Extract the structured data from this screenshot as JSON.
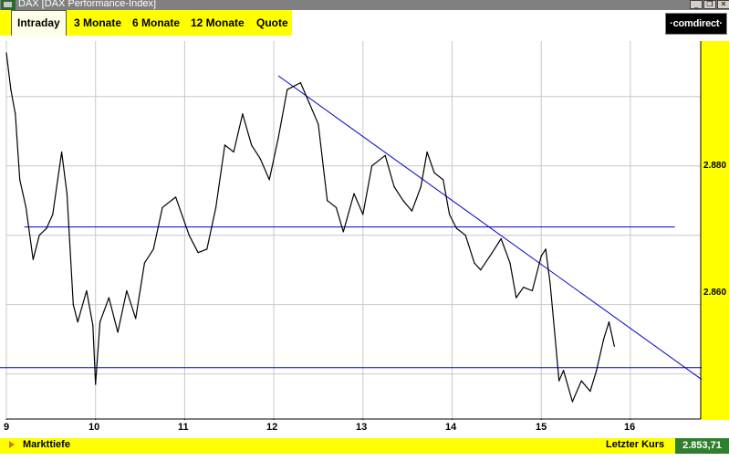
{
  "window": {
    "title": "DAX [DAX Performance-Index]",
    "buttons": [
      {
        "name": "minimize",
        "glyph": "_"
      },
      {
        "name": "maximize",
        "glyph": "❐"
      },
      {
        "name": "close",
        "glyph": "✕"
      }
    ]
  },
  "tabs": [
    {
      "label": "Intraday",
      "active": true
    },
    {
      "label": "3 Monate",
      "active": false
    },
    {
      "label": "6 Monate",
      "active": false
    },
    {
      "label": "12 Monate",
      "active": false
    },
    {
      "label": "Quote",
      "active": false
    }
  ],
  "brand": {
    "logo": "·comdirect·"
  },
  "bottom": {
    "left_label": "Markttiefe",
    "right_label": "Letzter Kurs",
    "last_price": "2.853,71"
  },
  "colors": {
    "accent_yellow": "#ffff00",
    "price_line": "#000000",
    "trendline_blue": "#0000cc",
    "grid": "#c8c8c8",
    "last_price_bg": "#2f7f2f"
  },
  "chart_data": {
    "type": "line",
    "x_ticks": [
      "9",
      "10",
      "11",
      "12",
      "13",
      "14",
      "15",
      "16"
    ],
    "y_ticks": [
      "2.880",
      "2.860"
    ],
    "x_range": [
      9,
      16.8
    ],
    "y_range": [
      2843.5,
      2898
    ],
    "grid": true,
    "series": [
      {
        "values": [
          [
            9.0,
            2896.3
          ],
          [
            9.05,
            2891.0
          ],
          [
            9.1,
            2887.5
          ],
          [
            9.15,
            2878.0
          ],
          [
            9.22,
            2874.0
          ],
          [
            9.3,
            2866.5
          ],
          [
            9.37,
            2870.0
          ],
          [
            9.45,
            2871.0
          ],
          [
            9.52,
            2873.0
          ],
          [
            9.62,
            2882.0
          ],
          [
            9.68,
            2876.0
          ],
          [
            9.75,
            2860.0
          ],
          [
            9.8,
            2857.5
          ],
          [
            9.9,
            2862.0
          ],
          [
            9.97,
            2857.0
          ],
          [
            10.0,
            2848.5
          ],
          [
            10.05,
            2857.5
          ],
          [
            10.15,
            2861.0
          ],
          [
            10.25,
            2856.0
          ],
          [
            10.35,
            2862.0
          ],
          [
            10.45,
            2858.0
          ],
          [
            10.55,
            2866.0
          ],
          [
            10.65,
            2868.0
          ],
          [
            10.75,
            2874.0
          ],
          [
            10.9,
            2875.5
          ],
          [
            11.05,
            2870.0
          ],
          [
            11.15,
            2867.5
          ],
          [
            11.25,
            2868.0
          ],
          [
            11.35,
            2874.0
          ],
          [
            11.45,
            2883.0
          ],
          [
            11.55,
            2882.0
          ],
          [
            11.65,
            2887.5
          ],
          [
            11.75,
            2883.0
          ],
          [
            11.85,
            2881.0
          ],
          [
            11.95,
            2878.0
          ],
          [
            12.05,
            2884.0
          ],
          [
            12.15,
            2891.0
          ],
          [
            12.3,
            2892.0
          ],
          [
            12.4,
            2889.0
          ],
          [
            12.5,
            2886.0
          ],
          [
            12.6,
            2875.0
          ],
          [
            12.7,
            2874.0
          ],
          [
            12.78,
            2870.5
          ],
          [
            12.9,
            2876.0
          ],
          [
            13.0,
            2873.0
          ],
          [
            13.1,
            2880.0
          ],
          [
            13.25,
            2881.5
          ],
          [
            13.35,
            2877.0
          ],
          [
            13.45,
            2875.0
          ],
          [
            13.55,
            2873.5
          ],
          [
            13.65,
            2877.0
          ],
          [
            13.72,
            2882.0
          ],
          [
            13.8,
            2879.0
          ],
          [
            13.9,
            2878.0
          ],
          [
            13.97,
            2873.0
          ],
          [
            14.05,
            2871.0
          ],
          [
            14.15,
            2870.0
          ],
          [
            14.25,
            2866.0
          ],
          [
            14.32,
            2865.0
          ],
          [
            14.45,
            2867.5
          ],
          [
            14.55,
            2869.5
          ],
          [
            14.65,
            2866.0
          ],
          [
            14.72,
            2861.0
          ],
          [
            14.8,
            2862.5
          ],
          [
            14.9,
            2862.0
          ],
          [
            15.0,
            2867.0
          ],
          [
            15.05,
            2868.0
          ],
          [
            15.1,
            2863.0
          ],
          [
            15.15,
            2856.0
          ],
          [
            15.2,
            2849.0
          ],
          [
            15.25,
            2850.5
          ],
          [
            15.35,
            2846.0
          ],
          [
            15.45,
            2849.0
          ],
          [
            15.55,
            2847.5
          ],
          [
            15.62,
            2850.5
          ],
          [
            15.7,
            2855.0
          ],
          [
            15.76,
            2857.5
          ],
          [
            15.82,
            2854.0
          ]
        ]
      }
    ],
    "annotations": [
      {
        "type": "hline",
        "y": 2871.2,
        "x_from": 9.2,
        "x_to": 16.5
      },
      {
        "type": "hline",
        "y": 2850.9,
        "x_from": 8.55,
        "x_to": 16.8
      },
      {
        "type": "trendline",
        "from": [
          12.05,
          2893.0
        ],
        "to": [
          16.8,
          2849.2
        ]
      }
    ]
  }
}
